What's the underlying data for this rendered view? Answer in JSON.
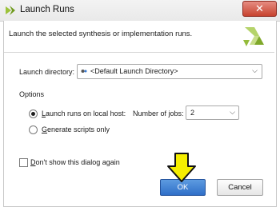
{
  "window": {
    "title": "Launch Runs",
    "close_glyph": "✕"
  },
  "header": {
    "description": "Launch the selected synthesis or implementation runs."
  },
  "launch_directory": {
    "label": "Launch directory:",
    "selected": "<Default Launch Directory>",
    "icon": "folder-link-icon"
  },
  "options": {
    "heading": "Options",
    "local_host_label": "Launch runs on local host:",
    "local_host_checked": true,
    "jobs_label": "Number of jobs:",
    "jobs_value": "2",
    "scripts_label": "Generate scripts only",
    "scripts_checked": false
  },
  "dont_show": {
    "label": "Don't show this dialog again",
    "checked": false
  },
  "buttons": {
    "ok": "OK",
    "cancel": "Cancel"
  },
  "colors": {
    "accent_arrow": "#f5ee00",
    "ok_button": "#3a7bd5",
    "close_button": "#c7432f",
    "logo_green": "#8fb832"
  }
}
